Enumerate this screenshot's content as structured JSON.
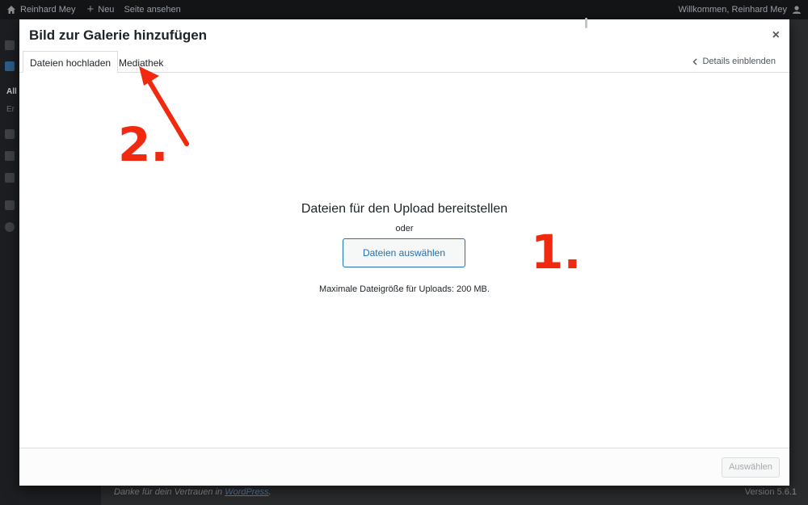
{
  "adminbar": {
    "site_name": "Reinhard Mey",
    "new_label": "Neu",
    "view_site": "Seite ansehen",
    "welcome": "Willkommen, Reinhard Mey"
  },
  "background": {
    "sidebar_current": "All",
    "sidebar_sub": "Er",
    "footer_thanks_prefix": "Danke für dein Vertrauen in ",
    "footer_thanks_link": "WordPress",
    "footer_thanks_suffix": ".",
    "version": "Version 5.6.1"
  },
  "modal": {
    "title": "Bild zur Galerie hinzufügen",
    "close_glyph": "×",
    "tabs": [
      {
        "label": "Dateien hochladen",
        "active": true
      },
      {
        "label": "Mediathek",
        "active": false
      }
    ],
    "details_link": "Details einblenden",
    "upload": {
      "title": "Dateien für den Upload bereitstellen",
      "or": "oder",
      "select_button": "Dateien auswählen",
      "max_size": "Maximale Dateigröße für Uploads: 200 MB."
    },
    "footer_button": "Auswählen"
  },
  "annotations": {
    "step1": "1.",
    "step2": "2."
  },
  "colors": {
    "accent": "#2271b1",
    "annotation": "#f0290f",
    "admin_bar": "#141517"
  }
}
